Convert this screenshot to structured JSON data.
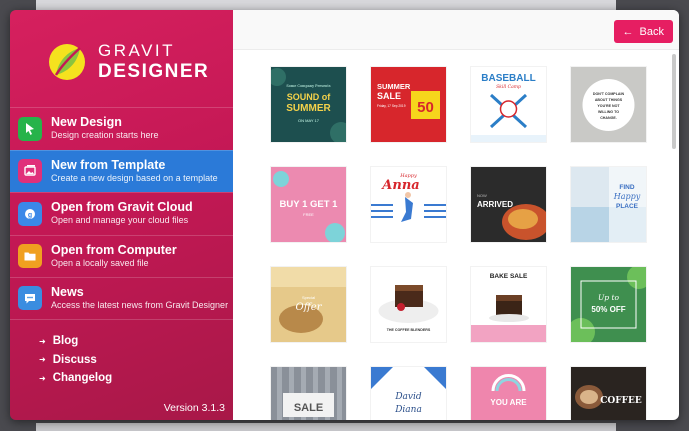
{
  "app": {
    "logo_line1": "GRAVIT",
    "logo_line2": "DESIGNER",
    "version": "Version 3.1.3"
  },
  "menu": [
    {
      "title": "New Design",
      "subtitle": "Design creation starts here",
      "icon": "cursor-icon",
      "color": "#26b34a"
    },
    {
      "title": "New from Template",
      "subtitle": "Create a new design based on a template",
      "icon": "template-icon",
      "color": "#e0307a"
    },
    {
      "title": "Open from Gravit Cloud",
      "subtitle": "Open and manage your cloud files",
      "icon": "cloud-icon",
      "color": "#3b88e8"
    },
    {
      "title": "Open from Computer",
      "subtitle": "Open a locally saved file",
      "icon": "folder-icon",
      "color": "#f0a020"
    },
    {
      "title": "News",
      "subtitle": "Access the latest news from Gravit Designer",
      "icon": "news-icon",
      "color": "#3a8de0"
    }
  ],
  "links": [
    "Blog",
    "Discuss",
    "Changelog"
  ],
  "back_label": "Back",
  "templates": {
    "t1": {
      "line1": "Some Company Presents",
      "line2": "SOUND of",
      "line3": "SUMMER",
      "line4": "ON MAY 17"
    },
    "t2": {
      "line1": "SUMMER",
      "line2": "SALE",
      "line3": "50",
      "line4": "Friday, 17 Sep 2019"
    },
    "t3": {
      "line1": "BASEBALL",
      "line2": "Skill Camp"
    },
    "t4": {
      "line1": "DON'T COMPLAIN",
      "line2": "ABOUT THINGS",
      "line3": "YOU'RE NOT",
      "line4": "WILLING TO",
      "line5": "CHANGE."
    },
    "t5": {
      "line1": "BUY 1 GET 1",
      "line2": "FREE"
    },
    "t6": {
      "line1": "Happy",
      "line2": "Anna"
    },
    "t7": {
      "line1": "NOW",
      "line2": "ARRIVED"
    },
    "t8": {
      "line1": "FIND",
      "line2": "Happy",
      "line3": "PLACE"
    },
    "t9": {
      "line1": "Special",
      "line2": "Offer"
    },
    "t10": {
      "line1": "THE COFFEE BLENDERS"
    },
    "t11": {
      "line1": "BAKE SALE"
    },
    "t12": {
      "line1": "Up to",
      "line2": "50% OFF"
    },
    "t13": {
      "line1": "SALE"
    },
    "t14": {
      "line1": "David",
      "line2": "Diana"
    },
    "t15": {
      "line1": "YOU ARE"
    },
    "t16": {
      "line1": "COFFEE"
    }
  }
}
